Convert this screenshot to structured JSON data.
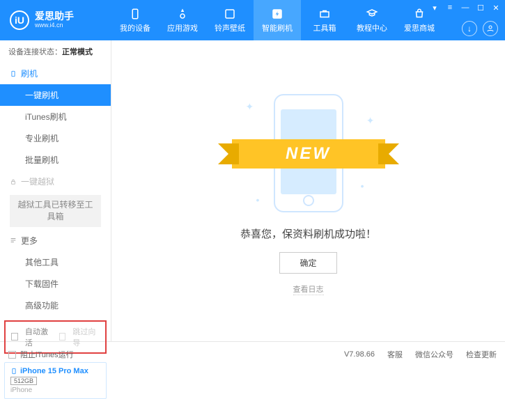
{
  "app": {
    "name": "爱思助手",
    "url": "www.i4.cn",
    "logo_letter": "iU"
  },
  "nav": [
    {
      "label": "我的设备"
    },
    {
      "label": "应用游戏"
    },
    {
      "label": "铃声壁纸"
    },
    {
      "label": "智能刷机"
    },
    {
      "label": "工具箱"
    },
    {
      "label": "教程中心"
    },
    {
      "label": "爱思商城"
    }
  ],
  "conn": {
    "label": "设备连接状态：",
    "value": "正常模式"
  },
  "sidebar": {
    "flash": {
      "title": "刷机",
      "items": [
        "一键刷机",
        "iTunes刷机",
        "专业刷机",
        "批量刷机"
      ]
    },
    "jailbreak": {
      "title": "一键越狱",
      "moved": "越狱工具已转移至工具箱"
    },
    "more": {
      "title": "更多",
      "items": [
        "其他工具",
        "下载固件",
        "高级功能"
      ]
    }
  },
  "options": {
    "auto_activate": "自动激活",
    "skip_guide": "跳过向导"
  },
  "device": {
    "name": "iPhone 15 Pro Max",
    "storage": "512GB",
    "type": "iPhone"
  },
  "main": {
    "ribbon": "NEW",
    "success": "恭喜您，保资料刷机成功啦！",
    "ok": "确定",
    "view_log": "查看日志"
  },
  "footer": {
    "block_itunes": "阻止iTunes运行",
    "version": "V7.98.66",
    "links": [
      "客服",
      "微信公众号",
      "检查更新"
    ]
  }
}
